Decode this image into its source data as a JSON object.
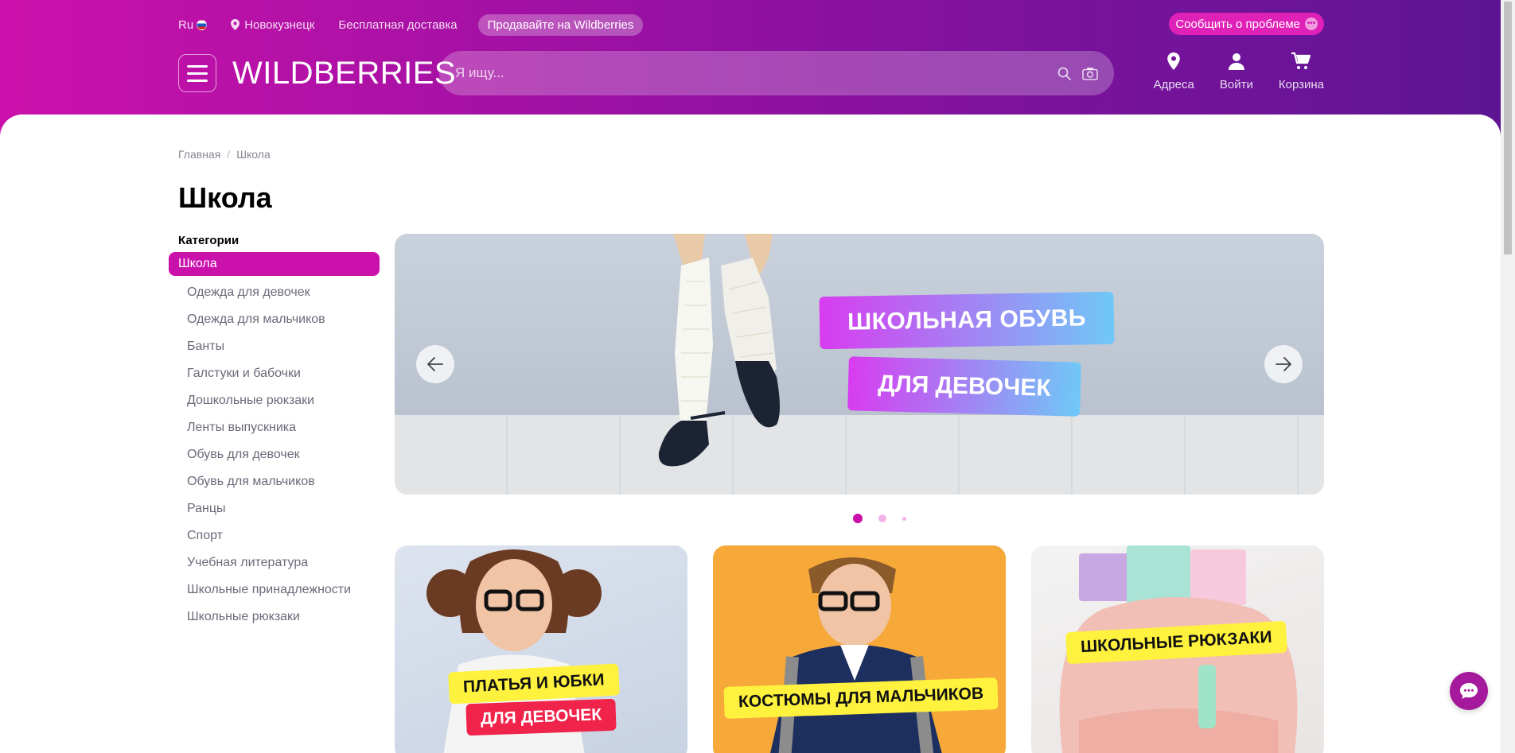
{
  "topbar": {
    "lang": "Ru",
    "city": "Новокузнецк",
    "delivery": "Бесплатная доставка",
    "sell": "Продавайте на Wildberries",
    "report": "Сообщить о проблеме"
  },
  "header": {
    "logo": "WILDBERRIES",
    "search_placeholder": "Я ищу...",
    "actions": {
      "addresses": "Адреса",
      "login": "Войти",
      "cart": "Корзина"
    }
  },
  "breadcrumb": {
    "home": "Главная",
    "current": "Школа"
  },
  "page_title": "Школа",
  "categories": {
    "heading": "Категории",
    "active": "Школа",
    "items": [
      "Одежда для девочек",
      "Одежда для мальчиков",
      "Банты",
      "Галстуки и бабочки",
      "Дошкольные рюкзаки",
      "Ленты выпускника",
      "Обувь для девочек",
      "Обувь для мальчиков",
      "Ранцы",
      "Спорт",
      "Учебная литература",
      "Школьные принадлежности",
      "Школьные рюкзаки"
    ]
  },
  "banner": {
    "line1": "ШКОЛЬНАЯ ОБУВЬ",
    "line2": "ДЛЯ ДЕВОЧЕК",
    "active_slide": 1,
    "slides": 3
  },
  "tiles": [
    {
      "label1": "ПЛАТЬЯ И ЮБКИ",
      "label2": "ДЛЯ ДЕВОЧЕК"
    },
    {
      "label1": "КОСТЮМЫ ДЛЯ МАЛЬЧИКОВ"
    },
    {
      "label1": "ШКОЛЬНЫЕ РЮКЗАКИ"
    }
  ],
  "colors": {
    "brand": "#cb11ab",
    "brand_dark": "#5c1593",
    "label_yellow": "#fff23e",
    "label_red": "#f0234a"
  }
}
